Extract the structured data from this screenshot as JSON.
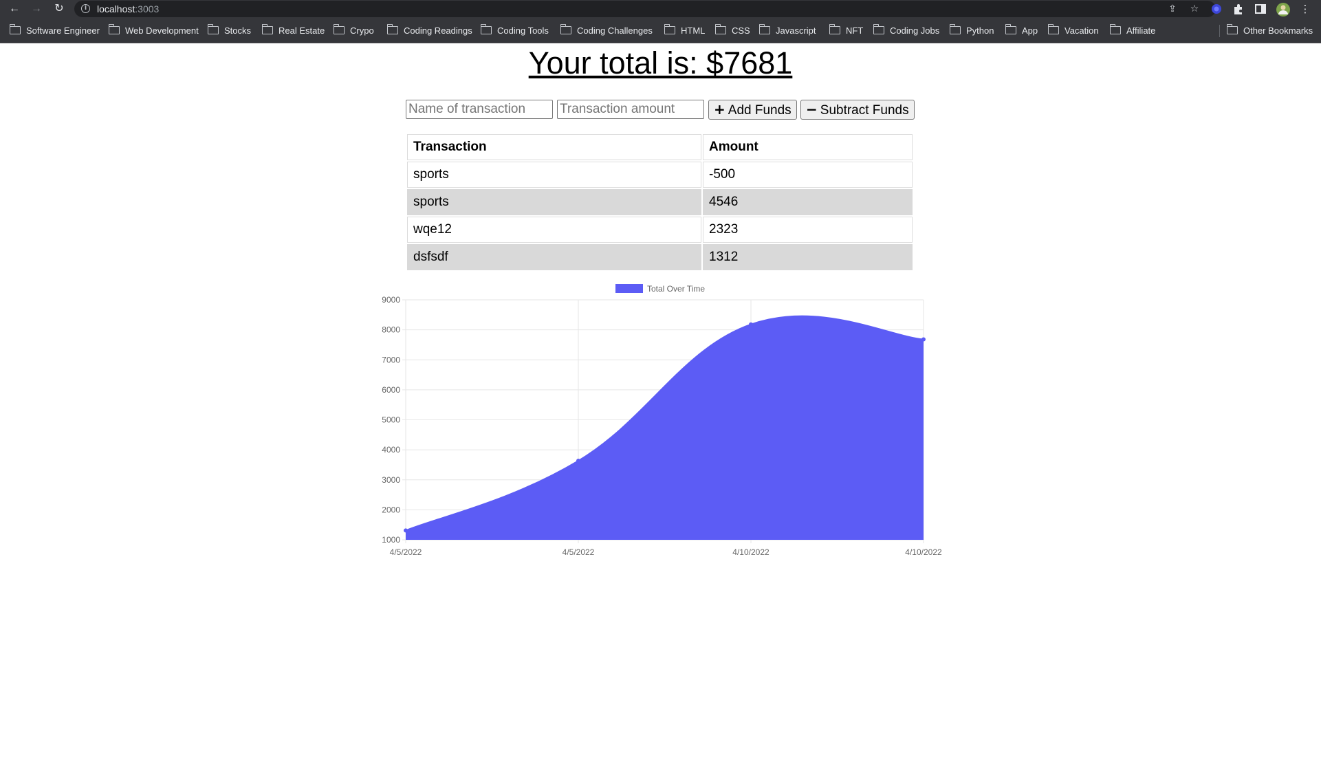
{
  "browser": {
    "url_host": "localhost",
    "url_port": ":3003",
    "bookmarks": [
      "Software Engineer",
      "Web Development",
      "Stocks",
      "Real Estate",
      "Crypo",
      "Coding Readings",
      "Coding Tools",
      "Coding Challenges",
      "HTML",
      "CSS",
      "Javascript",
      "NFT",
      "Coding Jobs",
      "Python",
      "App",
      "Vacation",
      "Affiliate"
    ],
    "other_bookmarks": "Other Bookmarks"
  },
  "page": {
    "total_text": "Your total is: $7681",
    "form": {
      "name_placeholder": "Name of transaction",
      "amount_placeholder": "Transaction amount",
      "add_label": "Add Funds",
      "subtract_label": "Subtract Funds"
    },
    "table": {
      "headers": [
        "Transaction",
        "Amount"
      ],
      "rows": [
        {
          "name": "sports",
          "amount": "-500"
        },
        {
          "name": "sports",
          "amount": "4546"
        },
        {
          "name": "wqe12",
          "amount": "2323"
        },
        {
          "name": "dsfsdf",
          "amount": "1312"
        }
      ]
    }
  },
  "chart_data": {
    "type": "area",
    "legend": "Total Over Time",
    "legend_position": "top",
    "categories": [
      "4/5/2022",
      "4/5/2022",
      "4/10/2022",
      "4/10/2022"
    ],
    "series": [
      {
        "name": "Total Over Time",
        "values": [
          1312,
          3635,
          8181,
          7681
        ]
      }
    ],
    "ylim": [
      1000,
      9000
    ],
    "yticks": [
      1000,
      2000,
      3000,
      4000,
      5000,
      6000,
      7000,
      8000,
      9000
    ],
    "grid": true,
    "fill_color": "#5c5cf5",
    "line_color": "#5c5cf5"
  }
}
